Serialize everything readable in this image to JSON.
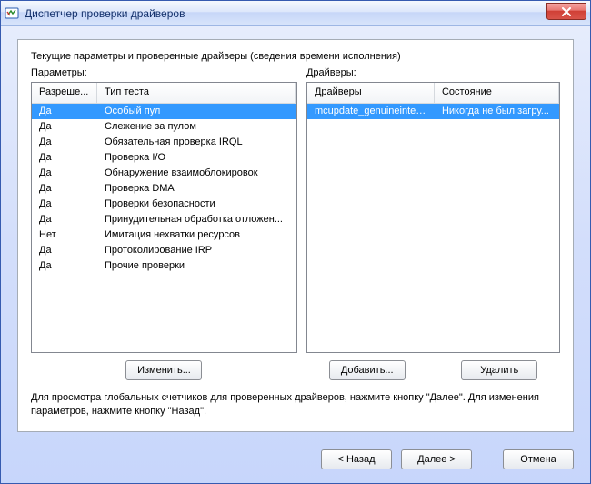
{
  "window": {
    "title": "Диспетчер проверки драйверов"
  },
  "heading": "Текущие параметры и проверенные драйверы (сведения времени исполнения)",
  "left": {
    "label": "Параметры:",
    "columns": {
      "c1": "Разреше...",
      "c2": "Тип теста"
    },
    "rows": [
      {
        "c1": "Да",
        "c2": "Особый пул",
        "selected": true
      },
      {
        "c1": "Да",
        "c2": "Слежение за пулом"
      },
      {
        "c1": "Да",
        "c2": "Обязательная проверка IRQL"
      },
      {
        "c1": "Да",
        "c2": "Проверка I/O"
      },
      {
        "c1": "Да",
        "c2": "Обнаружение взаимоблокировок"
      },
      {
        "c1": "Да",
        "c2": "Проверка DMA"
      },
      {
        "c1": "Да",
        "c2": "Проверки безопасности"
      },
      {
        "c1": "Да",
        "c2": "Принудительная обработка отложен..."
      },
      {
        "c1": "Нет",
        "c2": "Имитация нехватки ресурсов"
      },
      {
        "c1": "Да",
        "c2": "Протоколирование IRP"
      },
      {
        "c1": "Да",
        "c2": "Прочие проверки"
      }
    ],
    "button": "Изменить..."
  },
  "right": {
    "label": "Драйверы:",
    "columns": {
      "c1": "Драйверы",
      "c2": "Состояние"
    },
    "rows": [
      {
        "c1": "mcupdate_genuineintel.dll",
        "c2": "Никогда не был загру...",
        "selected": true
      }
    ],
    "buttons": {
      "add": "Добавить...",
      "remove": "Удалить"
    }
  },
  "hint": "Для просмотра глобальных счетчиков для проверенных драйверов, нажмите кнопку \"Далее\". Для изменения параметров, нажмите кнопку \"Назад\".",
  "footer": {
    "back": "< Назад",
    "next": "Далее >",
    "cancel": "Отмена"
  }
}
